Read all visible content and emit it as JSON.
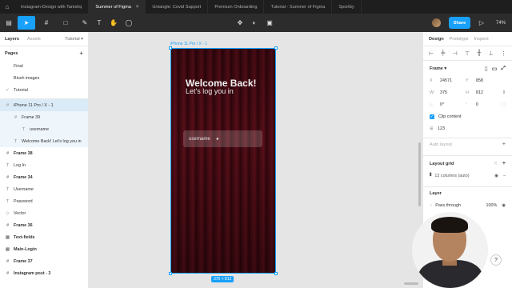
{
  "tabs": [
    {
      "label": "Instagram-Design with Tanishq",
      "active": false
    },
    {
      "label": "Summer of Figma",
      "active": true
    },
    {
      "label": "Untangle: Covid Support",
      "active": false
    },
    {
      "label": "Premium Onboarding",
      "active": false
    },
    {
      "label": "Tutorial - Summer of Figma",
      "active": false
    },
    {
      "label": "Sportby",
      "active": false
    }
  ],
  "toolbar": {
    "share_label": "Share",
    "zoom": "74%"
  },
  "left_panel": {
    "tab_layers": "Layers",
    "tab_assets": "Assets",
    "page_selector": "Tutorial",
    "pages_title": "Pages",
    "pages": [
      "Final",
      "Blush images",
      "Tutorial"
    ],
    "layers": [
      {
        "label": "iPhone 11 Pro / X - 1",
        "icon": "#",
        "level": 0,
        "state": "sel"
      },
      {
        "label": "Frame 39",
        "icon": "#",
        "level": 1,
        "state": "sub"
      },
      {
        "label": "username",
        "icon": "T",
        "level": 2,
        "state": "sub"
      },
      {
        "label": "Welcome Back! Let's log you in",
        "icon": "T",
        "level": 1,
        "state": "sub"
      },
      {
        "label": "Frame 38",
        "icon": "#",
        "level": 0,
        "state": "bold"
      },
      {
        "label": "Log In",
        "icon": "T",
        "level": 0,
        "state": ""
      },
      {
        "label": "Frame 34",
        "icon": "#",
        "level": 0,
        "state": "bold"
      },
      {
        "label": "Username",
        "icon": "T",
        "level": 0,
        "state": ""
      },
      {
        "label": "Password",
        "icon": "T",
        "level": 0,
        "state": ""
      },
      {
        "label": "Vector",
        "icon": "◇",
        "level": 0,
        "state": ""
      },
      {
        "label": "Frame 36",
        "icon": "#",
        "level": 0,
        "state": "bold"
      },
      {
        "label": "Text-fields",
        "icon": "▦",
        "level": 0,
        "state": "bold"
      },
      {
        "label": "Main-Login",
        "icon": "▦",
        "level": 0,
        "state": "bold"
      },
      {
        "label": "Frame 37",
        "icon": "#",
        "level": 0,
        "state": "bold"
      },
      {
        "label": "Instagram post - 3",
        "icon": "#",
        "level": 0,
        "state": "bold"
      }
    ]
  },
  "canvas": {
    "frame_label": "iPhone 11 Pro / X - 1",
    "welcome": "Welcome Back!",
    "sub": "Let's log you in",
    "username_placeholder": "username",
    "dims": "375 × 812"
  },
  "right_panel": {
    "tab_design": "Design",
    "tab_prototype": "Prototype",
    "tab_inspect": "Inspect",
    "frame_title": "Frame",
    "x_label": "X",
    "x": "24571",
    "y_label": "Y",
    "y": "858",
    "w_label": "W",
    "w": "375",
    "h_label": "H",
    "h": "812",
    "rot": "0°",
    "radius": "0",
    "clip_content": "Clip content",
    "grid_size": "123",
    "auto_layout": "Auto layout",
    "layout_grid": "Layout grid",
    "grid_value": "12 columns (auto)",
    "layer_title": "Layer",
    "blend": "Pass through",
    "opacity": "100%"
  }
}
